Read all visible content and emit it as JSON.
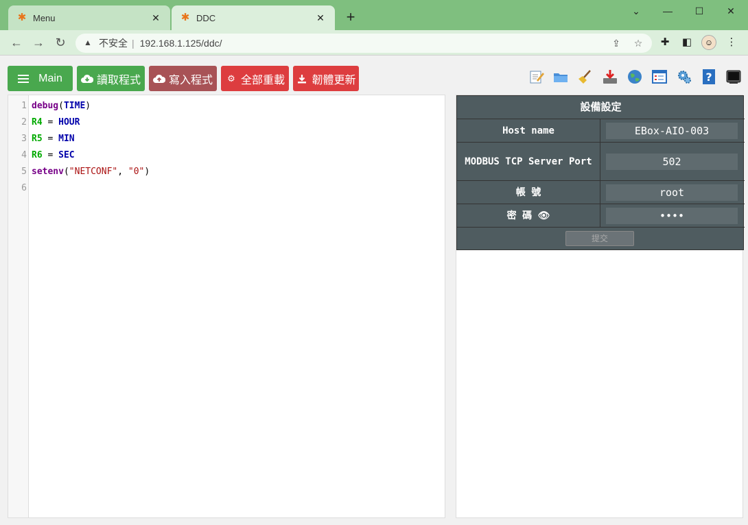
{
  "browser": {
    "tabs": [
      {
        "title": "Menu",
        "active": false
      },
      {
        "title": "DDC",
        "active": true
      }
    ],
    "address": {
      "security_label": "不安全",
      "separator": "|",
      "url": "192.168.1.125/ddc/"
    },
    "icons": [
      "back-icon",
      "forward-icon",
      "reload-icon",
      "share-icon",
      "star-icon",
      "extensions-icon",
      "sidebar-icon",
      "menu-icon"
    ]
  },
  "toolbar": {
    "main_label": "Main",
    "read_label": "讀取程式",
    "write_label": "寫入程式",
    "reload_all_label": "全部重載",
    "firmware_label": "韌體更新",
    "colors": {
      "green": "#49a84e",
      "maroon": "#a85256",
      "red": "#dd3d3f"
    }
  },
  "editor": {
    "lines": [
      {
        "n": "1",
        "parts": [
          {
            "t": "debug",
            "c": "k-fn"
          },
          {
            "t": "(",
            "c": ""
          },
          {
            "t": "TIME",
            "c": "k-kw"
          },
          {
            "t": ")",
            "c": ""
          }
        ]
      },
      {
        "n": "2",
        "parts": [
          {
            "t": "R4",
            "c": "k-var"
          },
          {
            "t": " = ",
            "c": ""
          },
          {
            "t": "HOUR",
            "c": "k-kw"
          }
        ]
      },
      {
        "n": "3",
        "parts": [
          {
            "t": "R5",
            "c": "k-var"
          },
          {
            "t": " = ",
            "c": ""
          },
          {
            "t": "MIN",
            "c": "k-kw"
          }
        ]
      },
      {
        "n": "4",
        "parts": [
          {
            "t": "R6",
            "c": "k-var"
          },
          {
            "t": " = ",
            "c": ""
          },
          {
            "t": "SEC",
            "c": "k-kw"
          }
        ]
      },
      {
        "n": "5",
        "parts": [
          {
            "t": "setenv",
            "c": "k-fn"
          },
          {
            "t": "(",
            "c": ""
          },
          {
            "t": "\"NETCONF\"",
            "c": "k-str"
          },
          {
            "t": ", ",
            "c": ""
          },
          {
            "t": "\"0\"",
            "c": "k-str"
          },
          {
            "t": ")",
            "c": ""
          }
        ]
      },
      {
        "n": "6",
        "parts": []
      }
    ]
  },
  "settings": {
    "title": "設備設定",
    "host_label": "Host name",
    "host_value": "EBox-AIO-003",
    "port_label": "MODBUS TCP Server Port",
    "port_value": "502",
    "account_label": "帳 號",
    "account_value": "root",
    "password_label": "密 碼 👁",
    "password_value": "••••",
    "submit_label": "提交"
  }
}
